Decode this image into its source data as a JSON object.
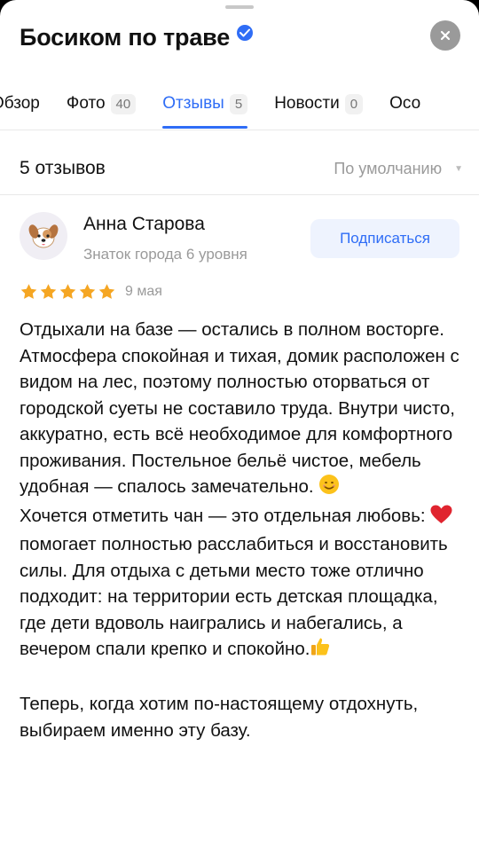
{
  "header": {
    "title": "Босиком по траве"
  },
  "tabs": [
    {
      "label": "Обзор",
      "count": ""
    },
    {
      "label": "Фото",
      "count": "40"
    },
    {
      "label": "Отзывы",
      "count": "5",
      "active": true
    },
    {
      "label": "Новости",
      "count": "0"
    },
    {
      "label": "Осо",
      "count": ""
    }
  ],
  "reviews": {
    "count_label": "5 отзывов",
    "sort_label": "По умолчанию"
  },
  "review": {
    "author_name": "Анна Старова",
    "author_level": "Знаток города 6 уровня",
    "subscribe_label": "Подписаться",
    "rating": 5,
    "date": "9 мая",
    "p1": "Отдыхали на базе — остались в полном восторге. Атмосфера спокойная и тихая, домик расположен с видом на лес, поэтому полностью оторваться от городской суеты не составило труда. Внутри чисто, аккуратно, есть всё необходимое для комфортного проживания. Постельное бельё чистое, мебель удобная — спалось замечательно.",
    "p2a": " Хочется отметить чан — это отдельная любовь: ",
    "p2b": "помогает полностью расслабиться и восстановить силы. Для отдыха с детьми место тоже отлично подходит: на территории есть детская площадка, где дети вдоволь наигрались и набегались, а вечером спали крепко и спокойно.",
    "p3": "Теперь, когда хотим по-настоящему отдохнуть, выбираем именно эту базу."
  },
  "colors": {
    "accent": "#2f6df6",
    "star": "#f5a623",
    "heart": "#e0242f"
  }
}
